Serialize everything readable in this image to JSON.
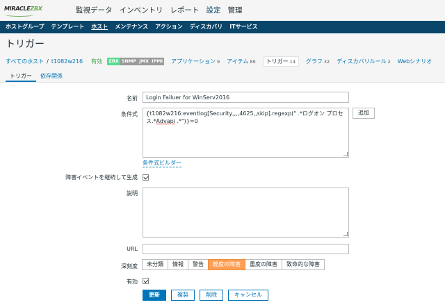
{
  "logo": {
    "text_left": "MIRACLE",
    "text_right": "ZBX",
    "sub": "ZBX"
  },
  "main_menu": [
    {
      "label": "監視データ",
      "active": false
    },
    {
      "label": "インベントリ",
      "active": false
    },
    {
      "label": "レポート",
      "active": false
    },
    {
      "label": "設定",
      "active": true
    },
    {
      "label": "管理",
      "active": false
    }
  ],
  "sub_menu": [
    {
      "label": "ホストグループ",
      "active": false
    },
    {
      "label": "テンプレート",
      "active": false
    },
    {
      "label": "ホスト",
      "active": true
    },
    {
      "label": "メンテナンス",
      "active": false
    },
    {
      "label": "アクション",
      "active": false
    },
    {
      "label": "ディスカバリ",
      "active": false
    },
    {
      "label": "ITサービス",
      "active": false
    }
  ],
  "page_title": "トリガー",
  "host_nav": {
    "all_hosts": "すべてのホスト",
    "separator": "/",
    "host": "t1082w216",
    "status": "有効",
    "badges": [
      "ZBX",
      "SNMP",
      "JMX",
      "IPMI"
    ],
    "items": [
      {
        "label": "アプリケーション",
        "count": "9"
      },
      {
        "label": "アイテム",
        "count": "89"
      },
      {
        "label": "トリガー",
        "count": "14",
        "current": true
      },
      {
        "label": "グラフ",
        "count": "32"
      },
      {
        "label": "ディスカバリルール",
        "count": "2"
      },
      {
        "label": "Webシナリオ",
        "count": ""
      }
    ]
  },
  "tabs": [
    {
      "label": "トリガー",
      "active": true
    },
    {
      "label": "依存関係",
      "active": false
    }
  ],
  "form": {
    "name_label": "名前",
    "name_value": "Login Failuer for WinServ2016",
    "expr_label": "条件式",
    "expr_line1_a": "{t1082w216:eventlog[Security,,,,4625,,skip].regexp(\" .*ログオン プロセ",
    "expr_line2_a": "ス.*",
    "expr_line2_ul": "Advapi",
    "expr_line2_b": " .*\")}=0",
    "add_button": "追加",
    "expr_builder": "条件式ビルダー",
    "multi_label": "障害イベントを継続して生成",
    "desc_label": "説明",
    "desc_value": "",
    "url_label": "URL",
    "url_value": "",
    "severity_label": "深刻度",
    "severities": [
      "未分類",
      "情報",
      "警告",
      "軽度の障害",
      "重度の障害",
      "致命的な障害"
    ],
    "severity_selected": 3,
    "enabled_label": "有効"
  },
  "actions": {
    "update": "更新",
    "clone": "複製",
    "delete": "削除",
    "cancel": "キャンセル"
  },
  "colors": {
    "nav_bg": "#0a466a",
    "link": "#0275b8",
    "severity_active": "#ff9f55",
    "zbx_badge": "#59db8f",
    "status_green": "#429e47"
  }
}
